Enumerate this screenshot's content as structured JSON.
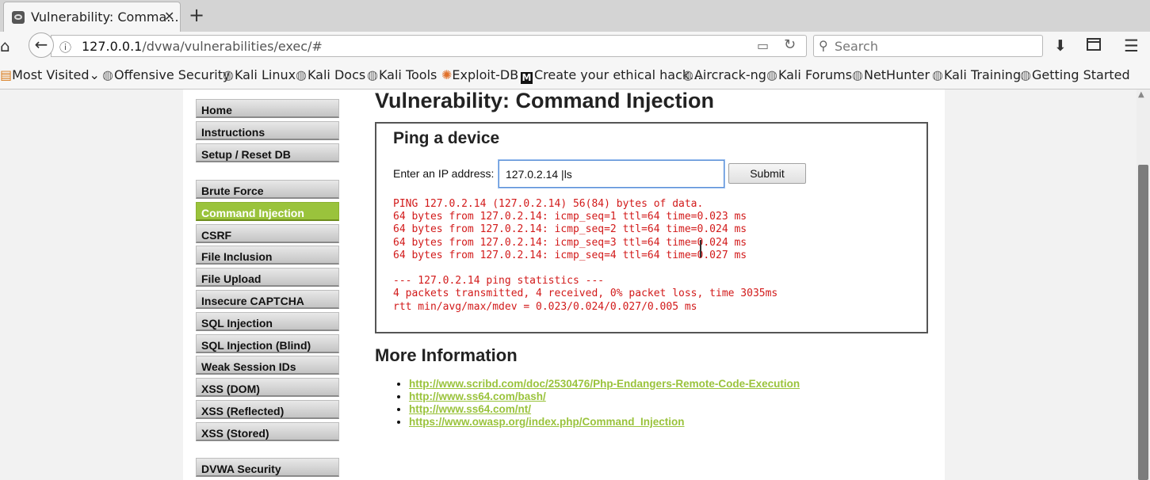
{
  "browser": {
    "tab_title": "Vulnerability: Comma...",
    "tab_close": "✕",
    "new_tab": "+",
    "url_host": "127.0.0.1",
    "url_path": "/dvwa/vulnerabilities/exec/#",
    "search_placeholder": "Search",
    "bookmarks": [
      "Most Visited",
      "Offensive Security",
      "Kali Linux",
      "Kali Docs",
      "Kali Tools",
      "Exploit-DB",
      "Create your ethical hack...",
      "Aircrack-ng",
      "Kali Forums",
      "NetHunter",
      "Kali Training",
      "Getting Started"
    ],
    "icons": [
      "home-icon",
      "back-arrow-icon",
      "info-icon",
      "reader-view-icon",
      "reload-icon",
      "search-icon",
      "download-icon",
      "library-icon",
      "hamburger-menu-icon"
    ]
  },
  "sidebar": {
    "items": [
      "Home",
      "Instructions",
      "Setup / Reset DB",
      "Brute Force",
      "Command Injection",
      "CSRF",
      "File Inclusion",
      "File Upload",
      "Insecure CAPTCHA",
      "SQL Injection",
      "SQL Injection (Blind)",
      "Weak Session IDs",
      "XSS (DOM)",
      "XSS (Reflected)",
      "XSS (Stored)",
      "DVWA Security"
    ],
    "selected": "Command Injection",
    "selected_color": "#9ac33c"
  },
  "main": {
    "heading": "Vulnerability: Command Injection",
    "box_title": "Ping a device",
    "ip_label": "Enter an IP address:",
    "ip_value": "127.0.2.14 |ls",
    "submit_label": "Submit",
    "output_lines": [
      "PING 127.0.2.14 (127.0.2.14) 56(84) bytes of data.",
      "64 bytes from 127.0.2.14: icmp_seq=1 ttl=64 time=0.023 ms",
      "64 bytes from 127.0.2.14: icmp_seq=2 ttl=64 time=0.024 ms",
      "64 bytes from 127.0.2.14: icmp_seq=3 ttl=64 time=0.024 ms",
      "64 bytes from 127.0.2.14: icmp_seq=4 ttl=64 time=0.027 ms",
      "",
      "--- 127.0.2.14 ping statistics ---",
      "4 packets transmitted, 4 received, 0% packet loss, time 3035ms",
      "rtt min/avg/max/mdev = 0.023/0.024/0.027/0.005 ms"
    ],
    "output_color": "#d21a1a",
    "more_info_title": "More Information",
    "links": [
      "http://www.scribd.com/doc/2530476/Php-Endangers-Remote-Code-Execution",
      "http://www.ss64.com/bash/",
      "http://www.ss64.com/nt/",
      "https://www.owasp.org/index.php/Command_Injection"
    ],
    "link_color": "#9ac33c"
  }
}
